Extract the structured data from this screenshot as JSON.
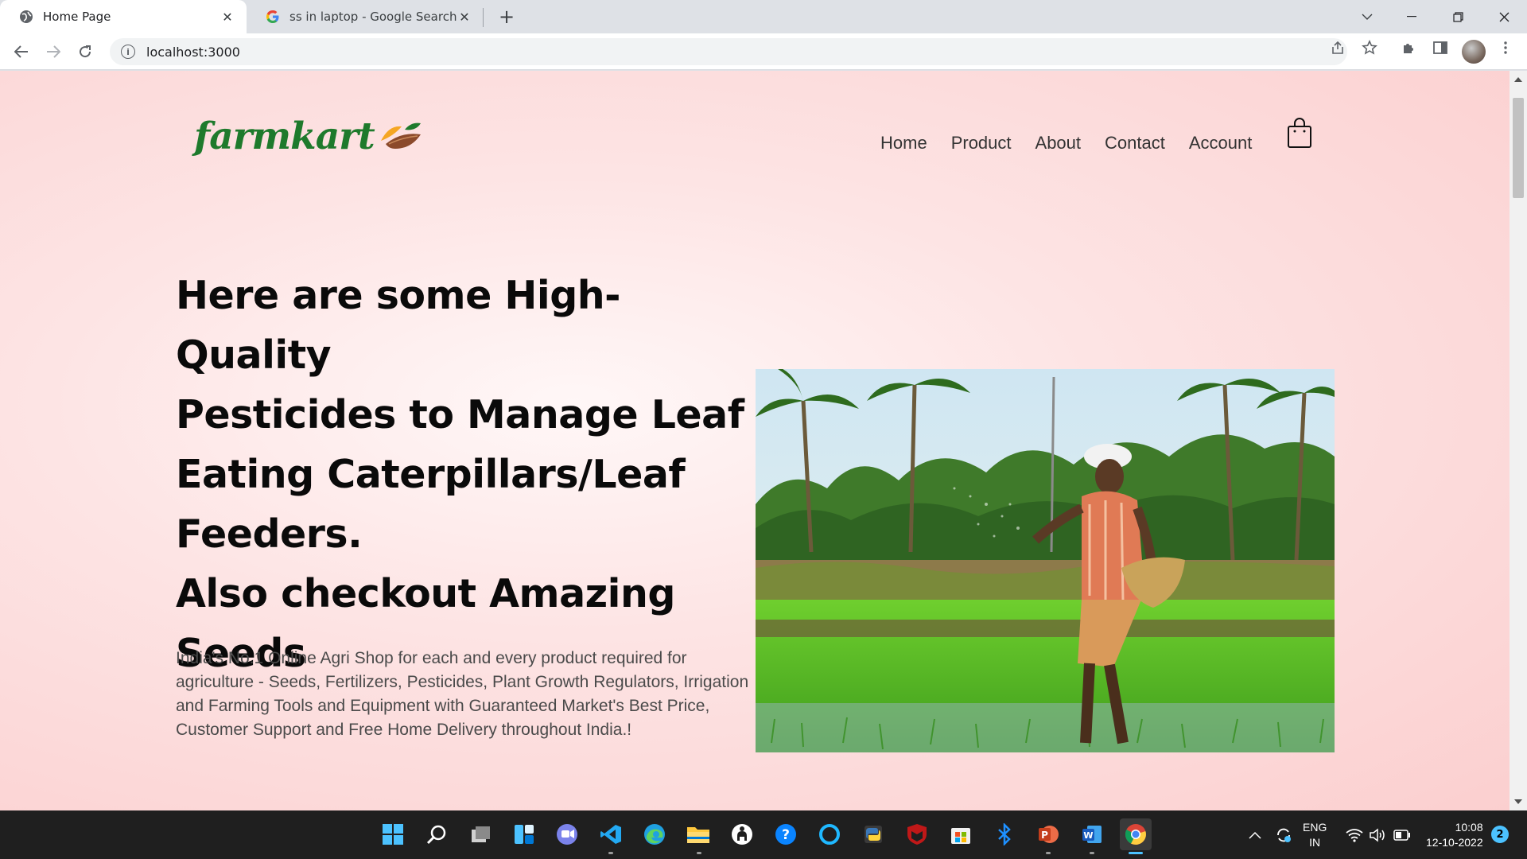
{
  "browser": {
    "tabs": [
      {
        "title": "Home Page",
        "favicon": "globe-icon",
        "active": true
      },
      {
        "title": "ss in laptop - Google Search",
        "favicon": "google-icon",
        "active": false
      }
    ],
    "url": "localhost:3000"
  },
  "site": {
    "logo_text": "farmkart",
    "nav": [
      "Home",
      "Product",
      "About",
      "Contact",
      "Account"
    ],
    "hero_title_lines": [
      "Here are some High-Quality",
      "Pesticides to Manage Leaf",
      "Eating Caterpillars/Leaf",
      "Feeders.",
      "Also checkout Amazing",
      "Seeds"
    ],
    "hero_description": "India's No.1 Online Agri Shop for each and every product required for agriculture - Seeds, Fertilizers, Pesticides, Plant Growth Regulators, Irrigation and Farming Tools and Equipment with Guaranteed Market's Best Price, Customer Support and Free Home Delivery throughout India.!"
  },
  "taskbar": {
    "apps": [
      "windows-start-icon",
      "search-icon",
      "task-view-icon",
      "widgets-icon",
      "teams-chat-icon",
      "vscode-icon",
      "edge-icon",
      "file-explorer-icon",
      "github-icon",
      "help-icon",
      "cortana-icon",
      "python-icon",
      "mcafee-icon",
      "microsoft-store-icon",
      "bluetooth-icon",
      "powerpoint-icon",
      "word-icon",
      "chrome-icon"
    ],
    "language": "ENG",
    "region": "IN",
    "time": "10:08",
    "date": "12-10-2022",
    "notification_count": "2"
  },
  "colors": {
    "brand_green": "#1e7a2c",
    "page_bg": "#fde4e4",
    "taskbar_bg": "#1f1f1f",
    "accent": "#4cc2ff"
  }
}
